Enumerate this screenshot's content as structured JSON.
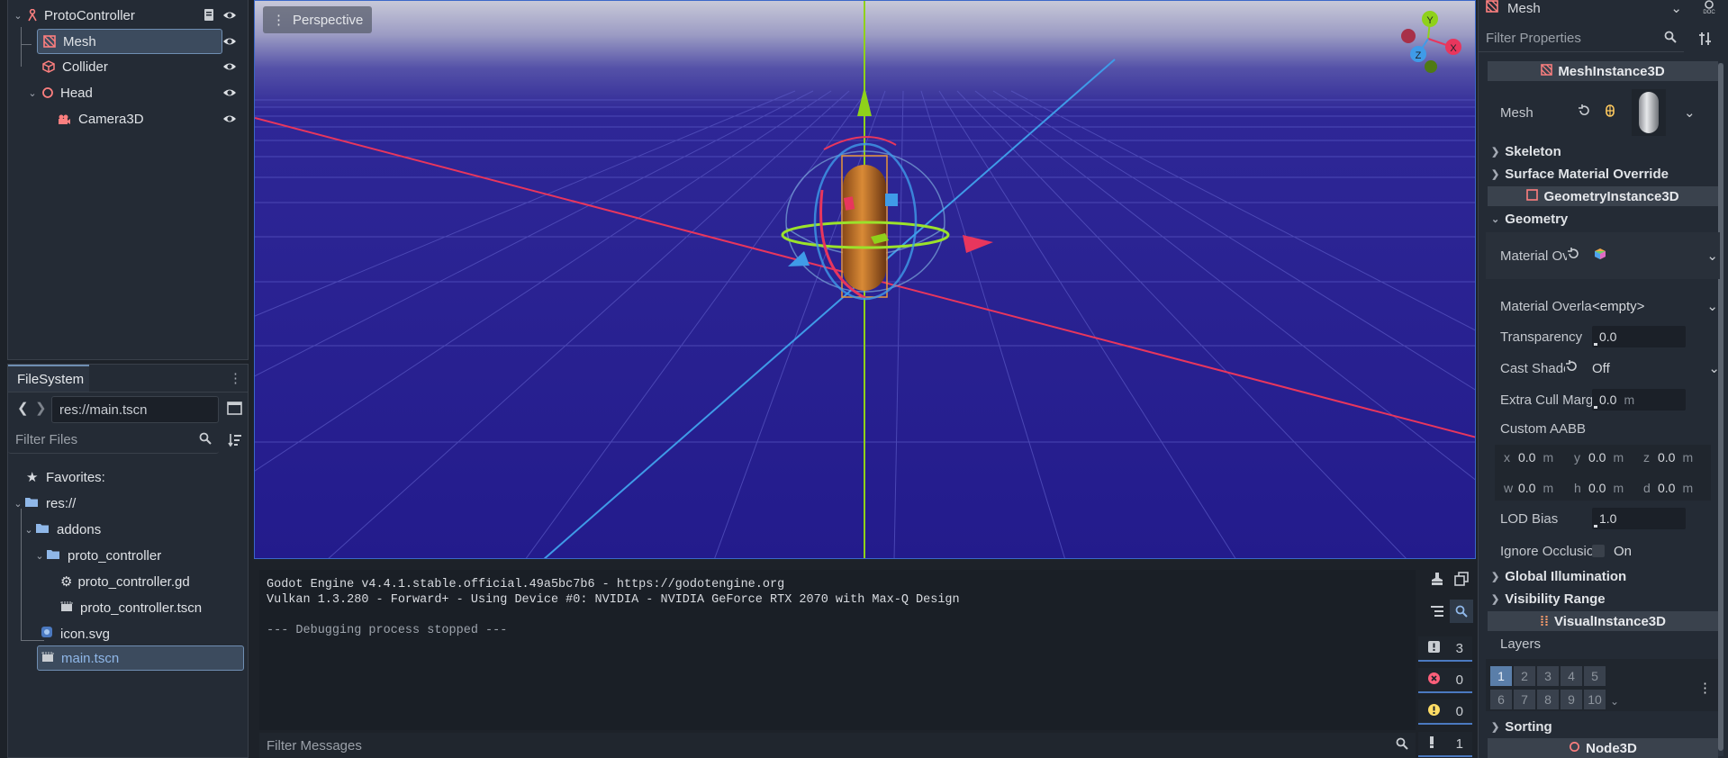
{
  "scene_tree": {
    "nodes": [
      {
        "label": "ProtoController"
      },
      {
        "label": "Mesh"
      },
      {
        "label": "Collider"
      },
      {
        "label": "Head"
      },
      {
        "label": "Camera3D"
      }
    ]
  },
  "filesystem": {
    "tab_label": "FileSystem",
    "path_value": "res://main.tscn",
    "filter_placeholder": "Filter Files",
    "items": [
      {
        "label": "Favorites:"
      },
      {
        "label": "res://"
      },
      {
        "label": "addons"
      },
      {
        "label": "proto_controller"
      },
      {
        "label": "proto_controller.gd"
      },
      {
        "label": "proto_controller.tscn"
      },
      {
        "label": "icon.svg"
      },
      {
        "label": "main.tscn"
      }
    ]
  },
  "viewport": {
    "perspective_label": "Perspective",
    "gizmo": {
      "y": "Y",
      "x": "X",
      "z": "Z"
    }
  },
  "output": {
    "lines": [
      "Godot Engine v4.4.1.stable.official.49a5bc7b6 - https://godotengine.org",
      "Vulkan 1.3.280 - Forward+ - Using Device #0: NVIDIA - NVIDIA GeForce RTX 2070 with Max-Q Design",
      "",
      "--- Debugging process stopped ---"
    ],
    "filter_placeholder": "Filter Messages",
    "counts": {
      "messages": "3",
      "errors": "0",
      "warnings": "0",
      "editor": "1"
    }
  },
  "inspector": {
    "node_selector": "Mesh",
    "filter_placeholder": "Filter Properties",
    "categories": {
      "mesh_instance": "MeshInstance3D",
      "geometry_instance": "GeometryInstance3D",
      "visual_instance": "VisualInstance3D",
      "node3d": "Node3D"
    },
    "sections": {
      "skeleton": "Skeleton",
      "surface_override": "Surface Material Override",
      "geometry": "Geometry",
      "global_illumination": "Global Illumination",
      "visibility_range": "Visibility Range",
      "sorting": "Sorting"
    },
    "props": {
      "mesh": "Mesh",
      "material_override": "Material Ov",
      "material_overlay": "Material Overla",
      "material_overlay_value": "<empty>",
      "transparency": "Transparency",
      "transparency_value": "0.0",
      "cast_shadow": "Cast Shado",
      "cast_shadow_value": "Off",
      "extra_cull": "Extra Cull Marg",
      "extra_cull_value": "0.0",
      "extra_cull_unit": "m",
      "custom_aabb": "Custom AABB",
      "aabb": {
        "x": "0.0",
        "y": "0.0",
        "z": "0.0",
        "w": "0.0",
        "h": "0.0",
        "d": "0.0",
        "unit": "m"
      },
      "lod_bias": "LOD Bias",
      "lod_bias_value": "1.0",
      "ignore_occlusion": "Ignore Occlusio",
      "ignore_occlusion_value": "On",
      "layers": "Layers"
    },
    "layers": [
      "1",
      "2",
      "3",
      "4",
      "5",
      "6",
      "7",
      "8",
      "9",
      "10"
    ],
    "active_layer": "1"
  },
  "colors": {
    "accent": "#6f8eb2",
    "viewport_bg": "#231b8c",
    "x_axis": "#e8365d",
    "y_axis": "#8fd11a",
    "z_axis": "#3f9be8",
    "node_icon": "#fc7f7f"
  }
}
